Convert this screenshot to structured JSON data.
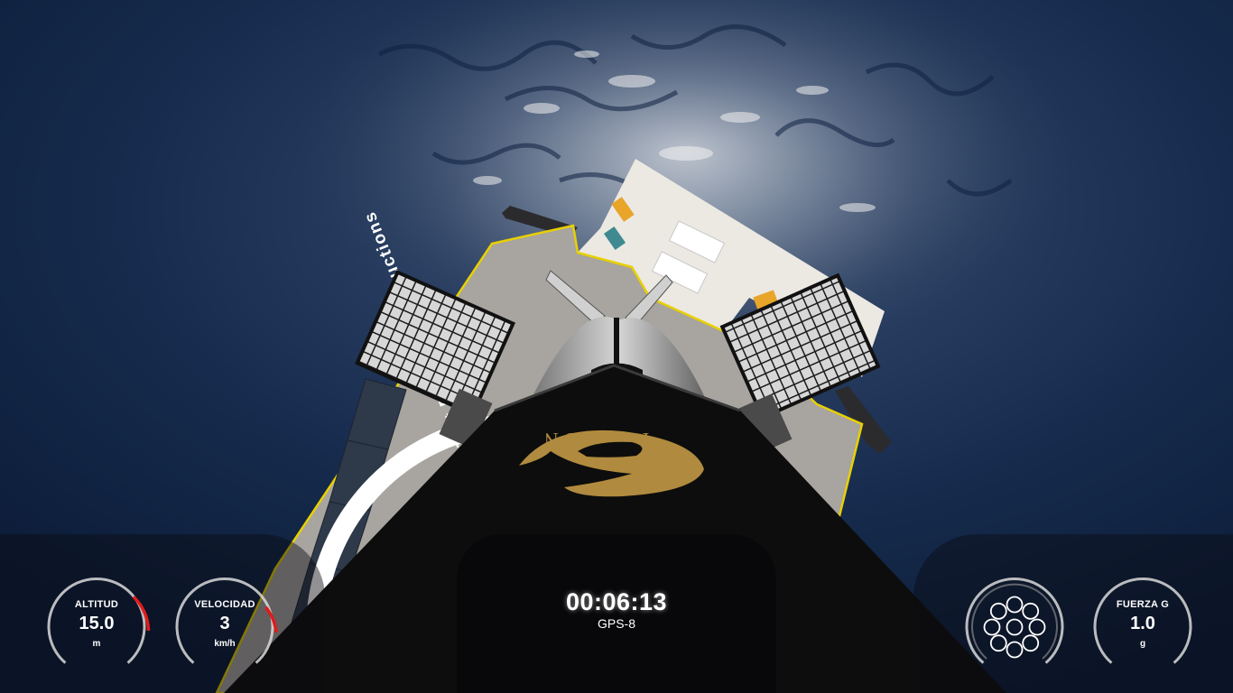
{
  "scene": {
    "vehicle_logo_text": "FALCON",
    "droneship_text": "Just Read The Instructions",
    "colors": {
      "ocean": "#12284a",
      "deck": "#a7a39d",
      "deck_stripe": "#e8d000",
      "rocket_body": "#0d0d0d",
      "logo_gold": "#b08a3e"
    }
  },
  "hud": {
    "altitude": {
      "label": "ALTITUD",
      "value": "15.0",
      "unit": "m",
      "level": 0.15
    },
    "velocity": {
      "label": "VELOCIDAD",
      "value": "3",
      "unit": "km/h",
      "level": 0.14
    },
    "timer": {
      "value": "00:06:13",
      "mission": "GPS-8"
    },
    "engines": {
      "icon": "merlin-engine-cluster-icon",
      "count": 9,
      "active": []
    },
    "gforce": {
      "label": "FUERZA G",
      "value": "1.0",
      "unit": "g",
      "level": 0.0
    },
    "colors": {
      "ring": "#d9d9d9",
      "red_zone": "#e21b1b",
      "text": "#ffffff"
    }
  }
}
